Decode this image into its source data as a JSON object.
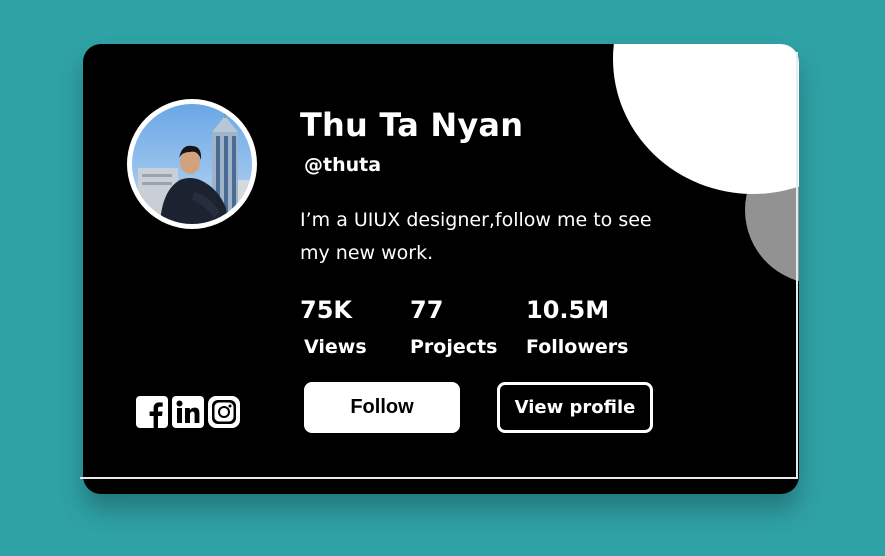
{
  "profile": {
    "name": "Thu Ta Nyan",
    "handle": "@thuta",
    "bio": "I’m a UIUX designer,follow me to see my new work.",
    "avatar_icon": "profile-photo"
  },
  "stats": [
    {
      "value": "75K",
      "label": "Views"
    },
    {
      "value": "77",
      "label": "Projects"
    },
    {
      "value": "10.5M",
      "label": "Followers"
    }
  ],
  "social": [
    {
      "icon": "facebook-icon"
    },
    {
      "icon": "linkedin-icon"
    },
    {
      "icon": "instagram-icon"
    }
  ],
  "actions": {
    "follow_label": "Follow",
    "view_profile_label": "View profile"
  },
  "colors": {
    "background": "#2fa2a6",
    "card": "#000000",
    "accent_white": "#ffffff",
    "accent_gray": "#929292"
  }
}
